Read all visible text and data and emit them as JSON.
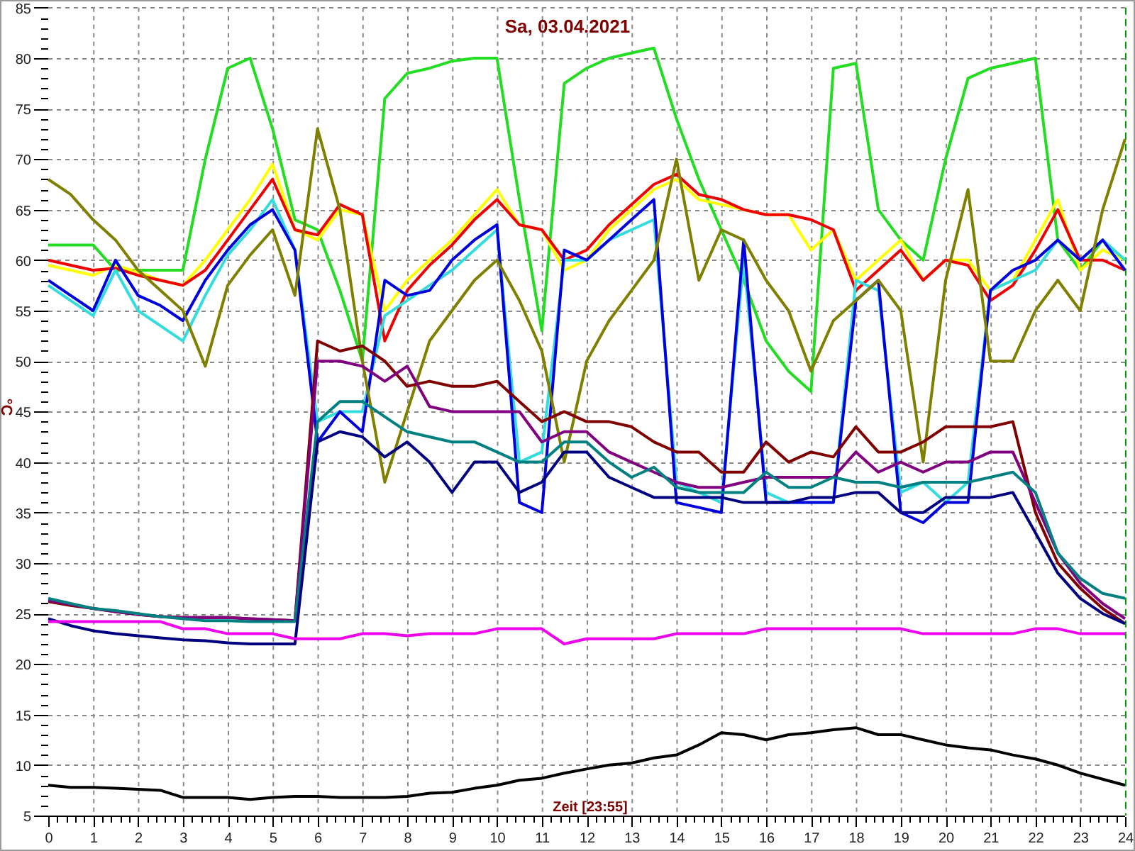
{
  "chart": {
    "chart_data": {
      "type": "line",
      "title": "Sa, 03.04.2021",
      "xlabel": "Zeit [23:55]",
      "ylabel": "°C",
      "grid": true,
      "xlim": [
        0,
        24
      ],
      "ylim": [
        5,
        85
      ],
      "xticks": [
        0,
        1,
        2,
        3,
        4,
        5,
        6,
        7,
        8,
        9,
        10,
        11,
        12,
        13,
        14,
        15,
        16,
        17,
        18,
        19,
        20,
        21,
        22,
        23,
        24
      ],
      "yticks": [
        5,
        10,
        15,
        20,
        25,
        30,
        35,
        40,
        45,
        50,
        55,
        60,
        65,
        70,
        75,
        80,
        85
      ],
      "x": [
        0,
        0.5,
        1,
        1.5,
        2,
        2.5,
        3,
        3.5,
        4,
        4.5,
        5,
        5.5,
        6,
        6.5,
        7,
        7.5,
        8,
        8.5,
        9,
        9.5,
        10,
        10.5,
        11,
        11.5,
        12,
        12.5,
        13,
        13.5,
        14,
        14.5,
        15,
        15.5,
        16,
        16.5,
        17,
        17.5,
        18,
        18.5,
        19,
        19.5,
        20,
        20.5,
        21,
        21.5,
        22,
        22.5,
        23,
        23.5,
        24
      ],
      "series": [
        {
          "color": "#22dd22",
          "values": [
            61.5,
            61.5,
            61.5,
            59,
            59,
            59,
            59,
            70,
            79,
            80,
            73,
            64,
            63,
            57,
            50,
            76,
            78.5,
            79,
            79.7,
            80,
            80,
            66,
            53,
            77.5,
            79,
            80,
            80.5,
            81,
            74,
            68,
            63,
            58,
            52,
            49,
            47,
            79,
            79.5,
            65,
            62,
            60,
            70,
            78,
            79,
            79.5,
            80,
            62,
            59,
            62,
            60
          ]
        },
        {
          "color": "#ffff00",
          "values": [
            59.5,
            59,
            58.5,
            59.5,
            58.8,
            58,
            57.5,
            60,
            63,
            66,
            69.5,
            63,
            62,
            65,
            64.5,
            55,
            58,
            60,
            62,
            64.5,
            67,
            63.5,
            63,
            59,
            60,
            63,
            65,
            67,
            68,
            66,
            65.5,
            65,
            64.5,
            64.5,
            61,
            63,
            58,
            60,
            62,
            58,
            60,
            60,
            57,
            58,
            62,
            66,
            59,
            61,
            60
          ]
        },
        {
          "color": "#ee0000",
          "values": [
            60,
            59.5,
            59,
            59.2,
            58.5,
            58,
            57.5,
            59,
            62,
            65,
            68,
            63,
            62.5,
            65.5,
            64.5,
            52,
            57,
            59.5,
            61.5,
            64,
            66,
            63.5,
            63,
            60,
            61,
            63.5,
            65.5,
            67.5,
            68.5,
            66.5,
            66,
            65,
            64.5,
            64.5,
            64,
            63,
            57,
            59,
            61,
            58,
            60,
            59.5,
            56,
            57.5,
            61,
            65,
            60,
            60,
            59
          ]
        },
        {
          "color": "#33dddd",
          "values": [
            57.5,
            56,
            54.5,
            59,
            55,
            53.5,
            52,
            56.5,
            60.5,
            63,
            66,
            61,
            44,
            45,
            45,
            54.5,
            56,
            57.5,
            59,
            61,
            63,
            40,
            41,
            60,
            60,
            62,
            63,
            64,
            38,
            37,
            36,
            60,
            37,
            36,
            36,
            36,
            58,
            57,
            37,
            38,
            36,
            38,
            57,
            58,
            59,
            62,
            60,
            62,
            60
          ]
        },
        {
          "color": "#0000dd",
          "values": [
            58,
            56.5,
            55,
            60,
            56.5,
            55.5,
            54,
            58,
            61,
            63.5,
            65,
            61,
            42,
            45,
            43,
            58,
            56.5,
            57,
            60,
            62,
            63.5,
            36,
            35,
            61,
            60,
            62,
            64,
            66,
            36,
            35.5,
            35,
            62,
            36,
            36,
            36,
            36,
            56,
            58,
            35,
            34,
            36,
            36,
            57,
            59,
            60,
            62,
            60,
            62,
            59
          ]
        },
        {
          "color": "#808000",
          "values": [
            68,
            66.5,
            64,
            62,
            59,
            57,
            55,
            49.5,
            57.5,
            60.5,
            63,
            56.5,
            73,
            65,
            50,
            38,
            45,
            52,
            55,
            58,
            60,
            56,
            51,
            40,
            50,
            54,
            57,
            60,
            70,
            58,
            63,
            62,
            58,
            55,
            49,
            54,
            56,
            58,
            55,
            40,
            58,
            67,
            50,
            50,
            55,
            58,
            55,
            65,
            72
          ]
        },
        {
          "color": "#800000",
          "values": [
            26.2,
            25.8,
            25.5,
            25.2,
            24.9,
            24.7,
            24.6,
            24.6,
            24.6,
            24.5,
            24.4,
            24.3,
            52,
            51,
            51.5,
            50,
            47.5,
            48,
            47.5,
            47.5,
            48,
            46,
            44,
            45,
            44,
            44,
            43.5,
            42,
            41,
            41,
            39,
            39,
            42,
            40,
            41,
            40.5,
            43.5,
            41,
            41,
            42,
            43.5,
            43.5,
            43.5,
            44,
            35,
            30,
            27.5,
            25.5,
            24
          ]
        },
        {
          "color": "#800080",
          "values": [
            26.3,
            25.9,
            25.5,
            25.2,
            24.9,
            24.7,
            24.6,
            24.6,
            24.6,
            24.5,
            24.4,
            24.3,
            50,
            50,
            49.5,
            48,
            49.5,
            45.5,
            45,
            45,
            45,
            45,
            42,
            43,
            43,
            41,
            40,
            39,
            38,
            37.5,
            37.5,
            38,
            38.5,
            38.5,
            38.5,
            38.5,
            41,
            39,
            40,
            39,
            40,
            40,
            41,
            41,
            36,
            31,
            28,
            26,
            24.5
          ]
        },
        {
          "color": "#008080",
          "values": [
            26.5,
            26,
            25.5,
            25.3,
            25,
            24.7,
            24.5,
            24.3,
            24.3,
            24.2,
            24.2,
            24.2,
            44,
            46,
            46,
            44.5,
            43,
            42.5,
            42,
            42,
            41,
            40,
            40,
            42,
            42,
            40,
            38.5,
            39.5,
            37.5,
            37,
            37,
            37,
            39,
            37.5,
            37.5,
            38.5,
            38,
            38,
            37.5,
            38,
            38,
            38,
            38.5,
            39,
            37,
            31,
            28.5,
            27,
            26.5
          ]
        },
        {
          "color": "#000080",
          "values": [
            24.5,
            23.8,
            23.3,
            23,
            22.8,
            22.6,
            22.4,
            22.3,
            22.1,
            22,
            22,
            22,
            42,
            43,
            42.5,
            40.5,
            42,
            40,
            37,
            40,
            40,
            37,
            38,
            41,
            41,
            38.5,
            37.5,
            36.5,
            36.5,
            36.5,
            36.5,
            36,
            36,
            36,
            36.5,
            36.5,
            37,
            37,
            35,
            35,
            36.5,
            36.5,
            36.5,
            37,
            33,
            29,
            26.5,
            25,
            24
          ]
        },
        {
          "color": "#ee00ee",
          "values": [
            24.2,
            24.2,
            24.2,
            24.2,
            24.2,
            24.2,
            23.5,
            23.5,
            23,
            23,
            23,
            22.5,
            22.5,
            22.5,
            23,
            23,
            22.8,
            23,
            23,
            23,
            23.5,
            23.5,
            23.5,
            22,
            22.5,
            22.5,
            22.5,
            22.5,
            23,
            23,
            23,
            23,
            23.5,
            23.5,
            23.5,
            23.5,
            23.5,
            23.5,
            23.5,
            23,
            23,
            23,
            23,
            23,
            23.5,
            23.5,
            23,
            23,
            23
          ]
        },
        {
          "color": "#000000",
          "values": [
            8,
            7.8,
            7.8,
            7.7,
            7.6,
            7.5,
            6.8,
            6.8,
            6.8,
            6.6,
            6.8,
            6.9,
            6.9,
            6.8,
            6.8,
            6.8,
            6.9,
            7.2,
            7.3,
            7.7,
            8,
            8.5,
            8.7,
            9.2,
            9.6,
            10,
            10.2,
            10.7,
            11,
            12,
            13.2,
            13,
            12.5,
            13,
            13.2,
            13.5,
            13.7,
            13,
            13,
            12.5,
            12,
            11.7,
            11.5,
            11,
            10.6,
            10,
            9.2,
            8.6,
            8
          ]
        }
      ]
    }
  }
}
